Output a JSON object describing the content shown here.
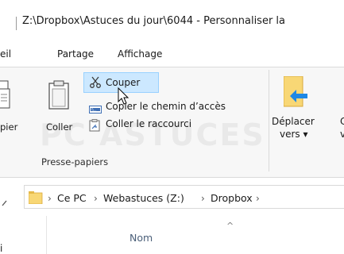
{
  "window": {
    "title": "Z:\\Dropbox\\Astuces du jour\\6044 - Personnaliser la"
  },
  "tabs": [
    {
      "label": "eil",
      "active": true
    },
    {
      "label": "Partage",
      "active": false
    },
    {
      "label": "Affichage",
      "active": false
    }
  ],
  "ribbon": {
    "copier_label": "pier",
    "coller_label": "Coller",
    "couper_label": "Couper",
    "copier_chemin_label": "Copier le chemin d’accès",
    "coller_raccourci_label": "Coller le raccourci",
    "group_label": "Presse-papiers",
    "deplacer_line1": "Déplacer",
    "deplacer_line2": "vers ▾",
    "next_line1": "C",
    "next_line2": "v"
  },
  "watermark": "PC ASTUCES",
  "address": {
    "crumbs": [
      "Ce PC",
      "Webastuces (Z:)",
      "Dropbox"
    ],
    "trailing": "›"
  },
  "file_list": {
    "column_name": "Nom",
    "sort_indicator": "^",
    "nav_item": "i"
  },
  "colors": {
    "accent_selected": "#cce8ff",
    "folder_yellow": "#f8d775",
    "arrow_blue": "#1e88e5"
  }
}
